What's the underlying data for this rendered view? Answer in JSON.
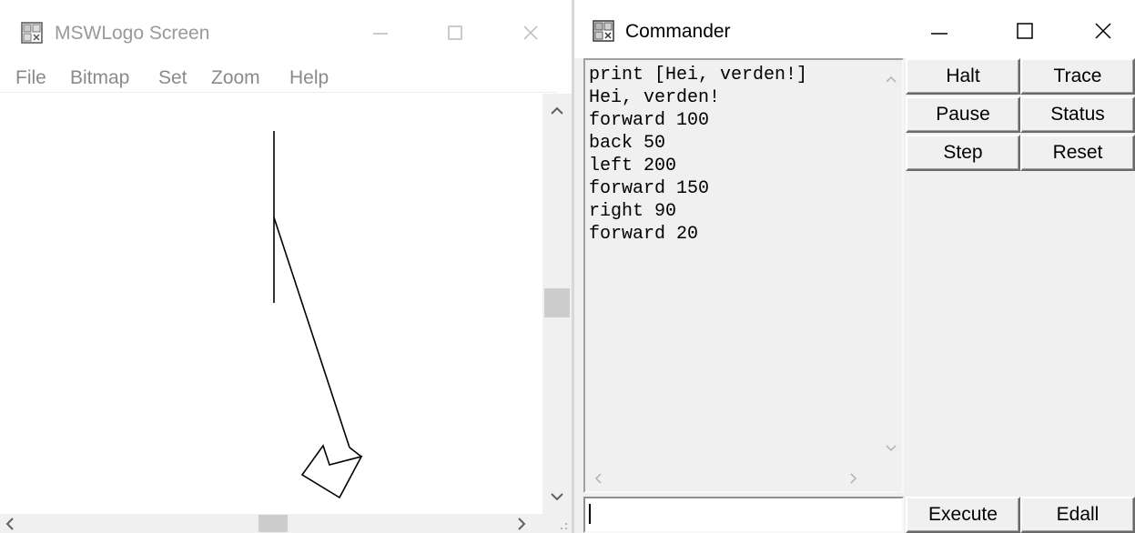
{
  "logo_window": {
    "title": "MSWLogo Screen",
    "icon": "logo-app-icon",
    "menu": [
      "File",
      "Bitmap",
      "Set",
      "Zoom",
      "Help"
    ]
  },
  "commander": {
    "title": "Commander",
    "icon": "logo-app-icon",
    "history": [
      "print [Hei, verden!]",
      "Hei, verden!",
      "forward 100",
      "back 50",
      "left 200",
      "forward 150",
      "right 90",
      "forward 20"
    ],
    "input_value": "",
    "buttons": {
      "halt": "Halt",
      "trace": "Trace",
      "pause": "Pause",
      "status": "Status",
      "step": "Step",
      "reset": "Reset",
      "execute": "Execute",
      "edall": "Edall"
    }
  }
}
